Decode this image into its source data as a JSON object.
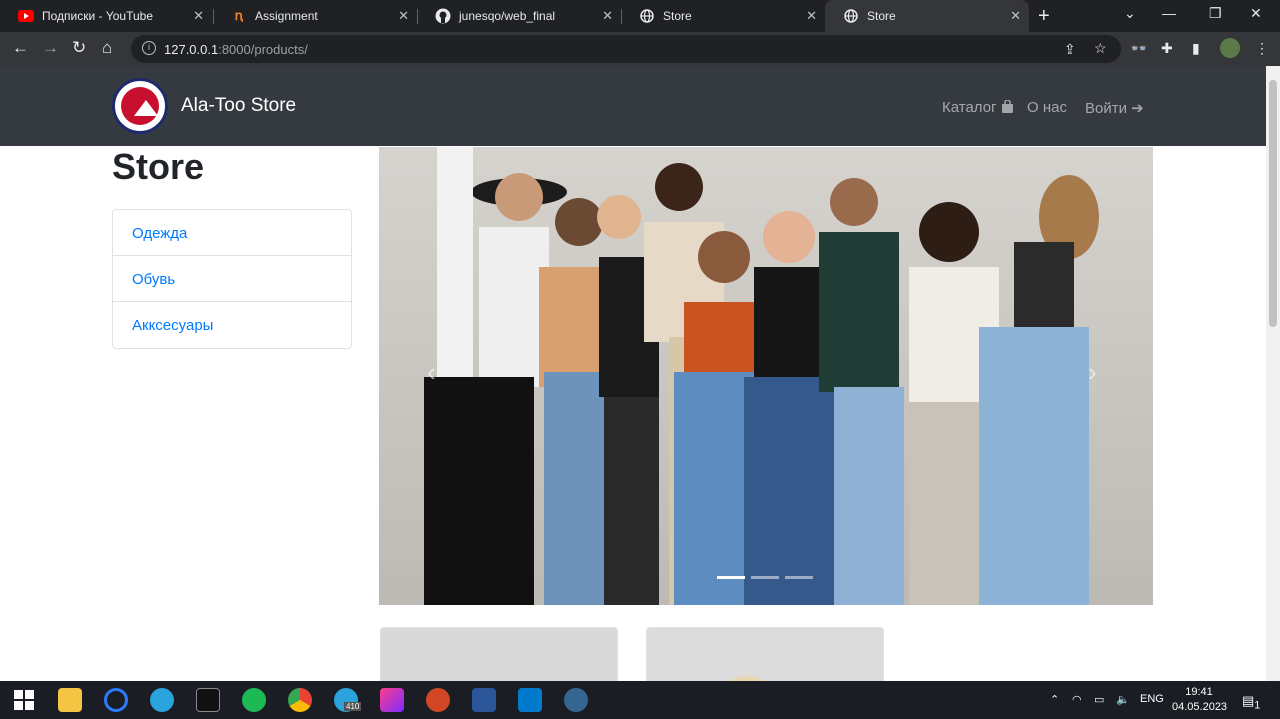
{
  "browser": {
    "tabs": [
      {
        "title": "Подписки - YouTube",
        "icon": "youtube-icon"
      },
      {
        "title": "Assignment",
        "icon": "assignment-icon"
      },
      {
        "title": "junesqo/web_final",
        "icon": "github-icon"
      },
      {
        "title": "Store",
        "icon": "globe-icon"
      },
      {
        "title": "Store",
        "icon": "globe-icon",
        "active": true
      }
    ],
    "url_host": "127.0.0.1",
    "url_rest": ":8000/products/"
  },
  "site": {
    "brand": "Ala-Too Store",
    "logo_text": "ALA-TOO",
    "nav": {
      "catalog": "Каталог",
      "about": "О нас",
      "login": "Войти"
    },
    "heading": "Store",
    "categories": [
      "Одежда",
      "Обувь",
      "Акксесуары"
    ],
    "carousel": {
      "slides": 3,
      "active_slide": 1
    }
  },
  "taskbar": {
    "lang": "ENG",
    "time": "19:41",
    "date": "04.05.2023",
    "notification_count": "1",
    "telegram_badge": "410"
  },
  "colors": {
    "navbar": "#343a40",
    "link": "#007bff",
    "chrome_dark": "#202124",
    "chrome_toolbar": "#35363a"
  }
}
